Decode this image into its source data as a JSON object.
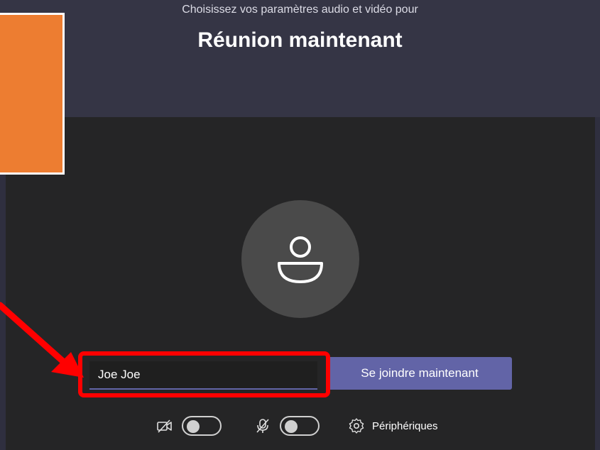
{
  "header": {
    "subtitle": "Choisissez vos paramètres audio et vidéo pour",
    "title": "Réunion maintenant"
  },
  "name_field": {
    "value": "Joe Joe"
  },
  "join_button": {
    "label": "Se joindre maintenant"
  },
  "controls": {
    "camera": {
      "icon": "camera-off-icon",
      "toggle": "off"
    },
    "microphone": {
      "icon": "mic-off-icon",
      "toggle": "off"
    },
    "devices": {
      "icon": "gear-icon",
      "label": "Périphériques"
    }
  },
  "colors": {
    "accent": "#6264a7",
    "annotation": "#ff0000",
    "overlay_box": "#ed7d31",
    "background": "#2f2f3f",
    "preview": "#252526"
  },
  "annotations": {
    "arrow_icon": "red-arrow-icon",
    "highlight": "red-outline-around-name-field"
  }
}
